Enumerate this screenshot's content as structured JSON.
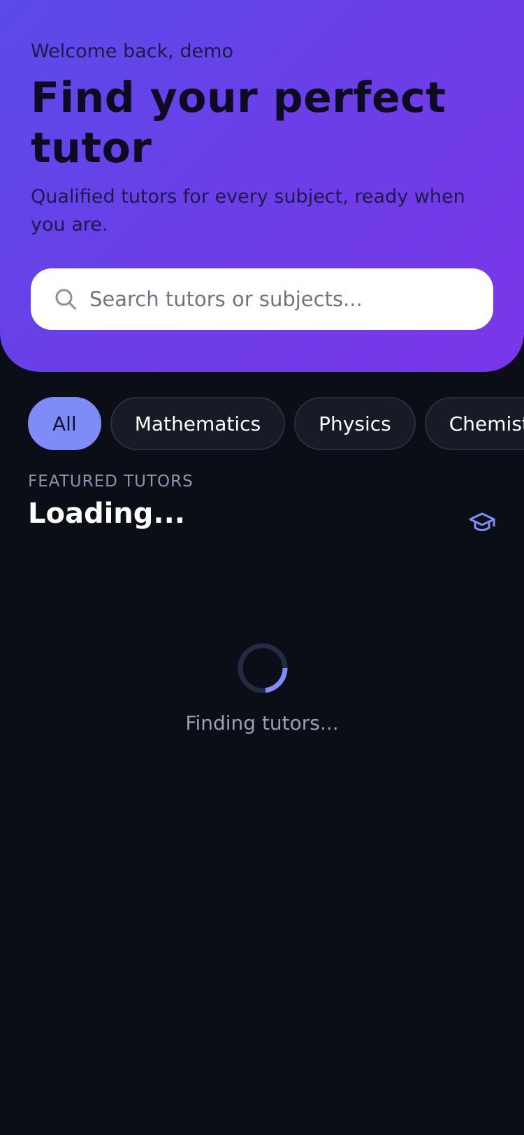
{
  "header": {
    "welcome": "Welcome back, demo",
    "title": "Find your perfect tutor",
    "subtitle": "Qualified tutors for every subject, ready when you are."
  },
  "search": {
    "placeholder": "Search tutors or subjects...",
    "icon": "search-icon"
  },
  "subjects": {
    "selected": "All",
    "items": [
      "All",
      "Mathematics",
      "Physics",
      "Chemistry"
    ]
  },
  "featured": {
    "eyebrow": "FEATURED TUTORS",
    "title": "Loading...",
    "icon": "graduation-cap-icon"
  },
  "loading": {
    "text": "Finding tutors..."
  },
  "colors": {
    "background": "#0b0e16",
    "hero_gradient_start": "#5b4be8",
    "hero_gradient_end": "#7a36e8",
    "accent": "#7f8cf7",
    "chip_background": "#181b26",
    "muted_text": "#9aa0b3"
  }
}
